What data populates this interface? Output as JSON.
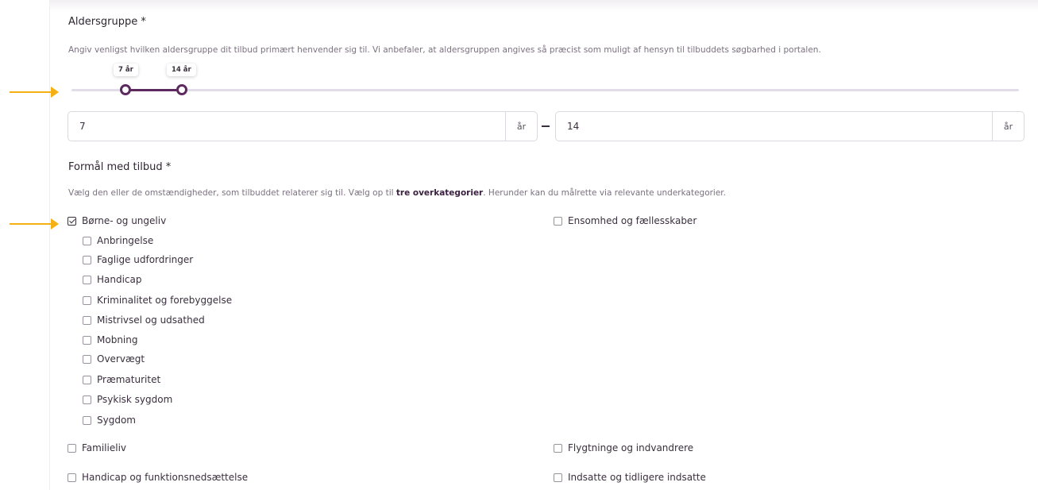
{
  "age": {
    "heading": "Aldersgruppe *",
    "description": "Angiv venligst hvilken aldersgruppe dit tilbud primært henvender sig til. Vi anbefaler, at aldersgruppen angives så præcist som muligt af hensyn til tilbuddets søgbarhed i portalen.",
    "min_bubble": "7 år",
    "max_bubble": "14 år",
    "min_value": "7",
    "max_value": "14",
    "unit": "år",
    "range_min": 7,
    "range_max": 14
  },
  "purpose": {
    "heading": "Formål med tilbud *",
    "description_before": "Vælg den eller de omstændigheder, som tilbuddet relaterer sig til. Vælg op til ",
    "description_bold": "tre overkategorier",
    "description_after": ". Herunder kan du målrette via relevante underkategorier.",
    "categories_left": [
      {
        "label": "Børne- og ungeliv",
        "checked": true
      },
      {
        "label": "Familieliv",
        "checked": false
      },
      {
        "label": "Handicap og funktionsnedsættelse",
        "checked": false
      }
    ],
    "subcategories": [
      {
        "label": "Anbringelse",
        "checked": false
      },
      {
        "label": "Faglige udfordringer",
        "checked": false
      },
      {
        "label": "Handicap",
        "checked": false
      },
      {
        "label": "Kriminalitet og forebyggelse",
        "checked": false
      },
      {
        "label": "Mistrivsel og udsathed",
        "checked": false
      },
      {
        "label": "Mobning",
        "checked": false
      },
      {
        "label": "Overvægt",
        "checked": false
      },
      {
        "label": "Præmaturitet",
        "checked": false
      },
      {
        "label": "Psykisk sygdom",
        "checked": false
      },
      {
        "label": "Sygdom",
        "checked": false
      }
    ],
    "categories_right": [
      {
        "label": "Ensomhed og fællesskaber",
        "checked": false
      },
      {
        "label": "Flygtninge og indvandrere",
        "checked": false
      },
      {
        "label": "Indsatte og tidligere indsatte",
        "checked": false
      }
    ]
  },
  "colors": {
    "accent": "#5d2a5f",
    "annotation_arrow": "#f5b014"
  }
}
